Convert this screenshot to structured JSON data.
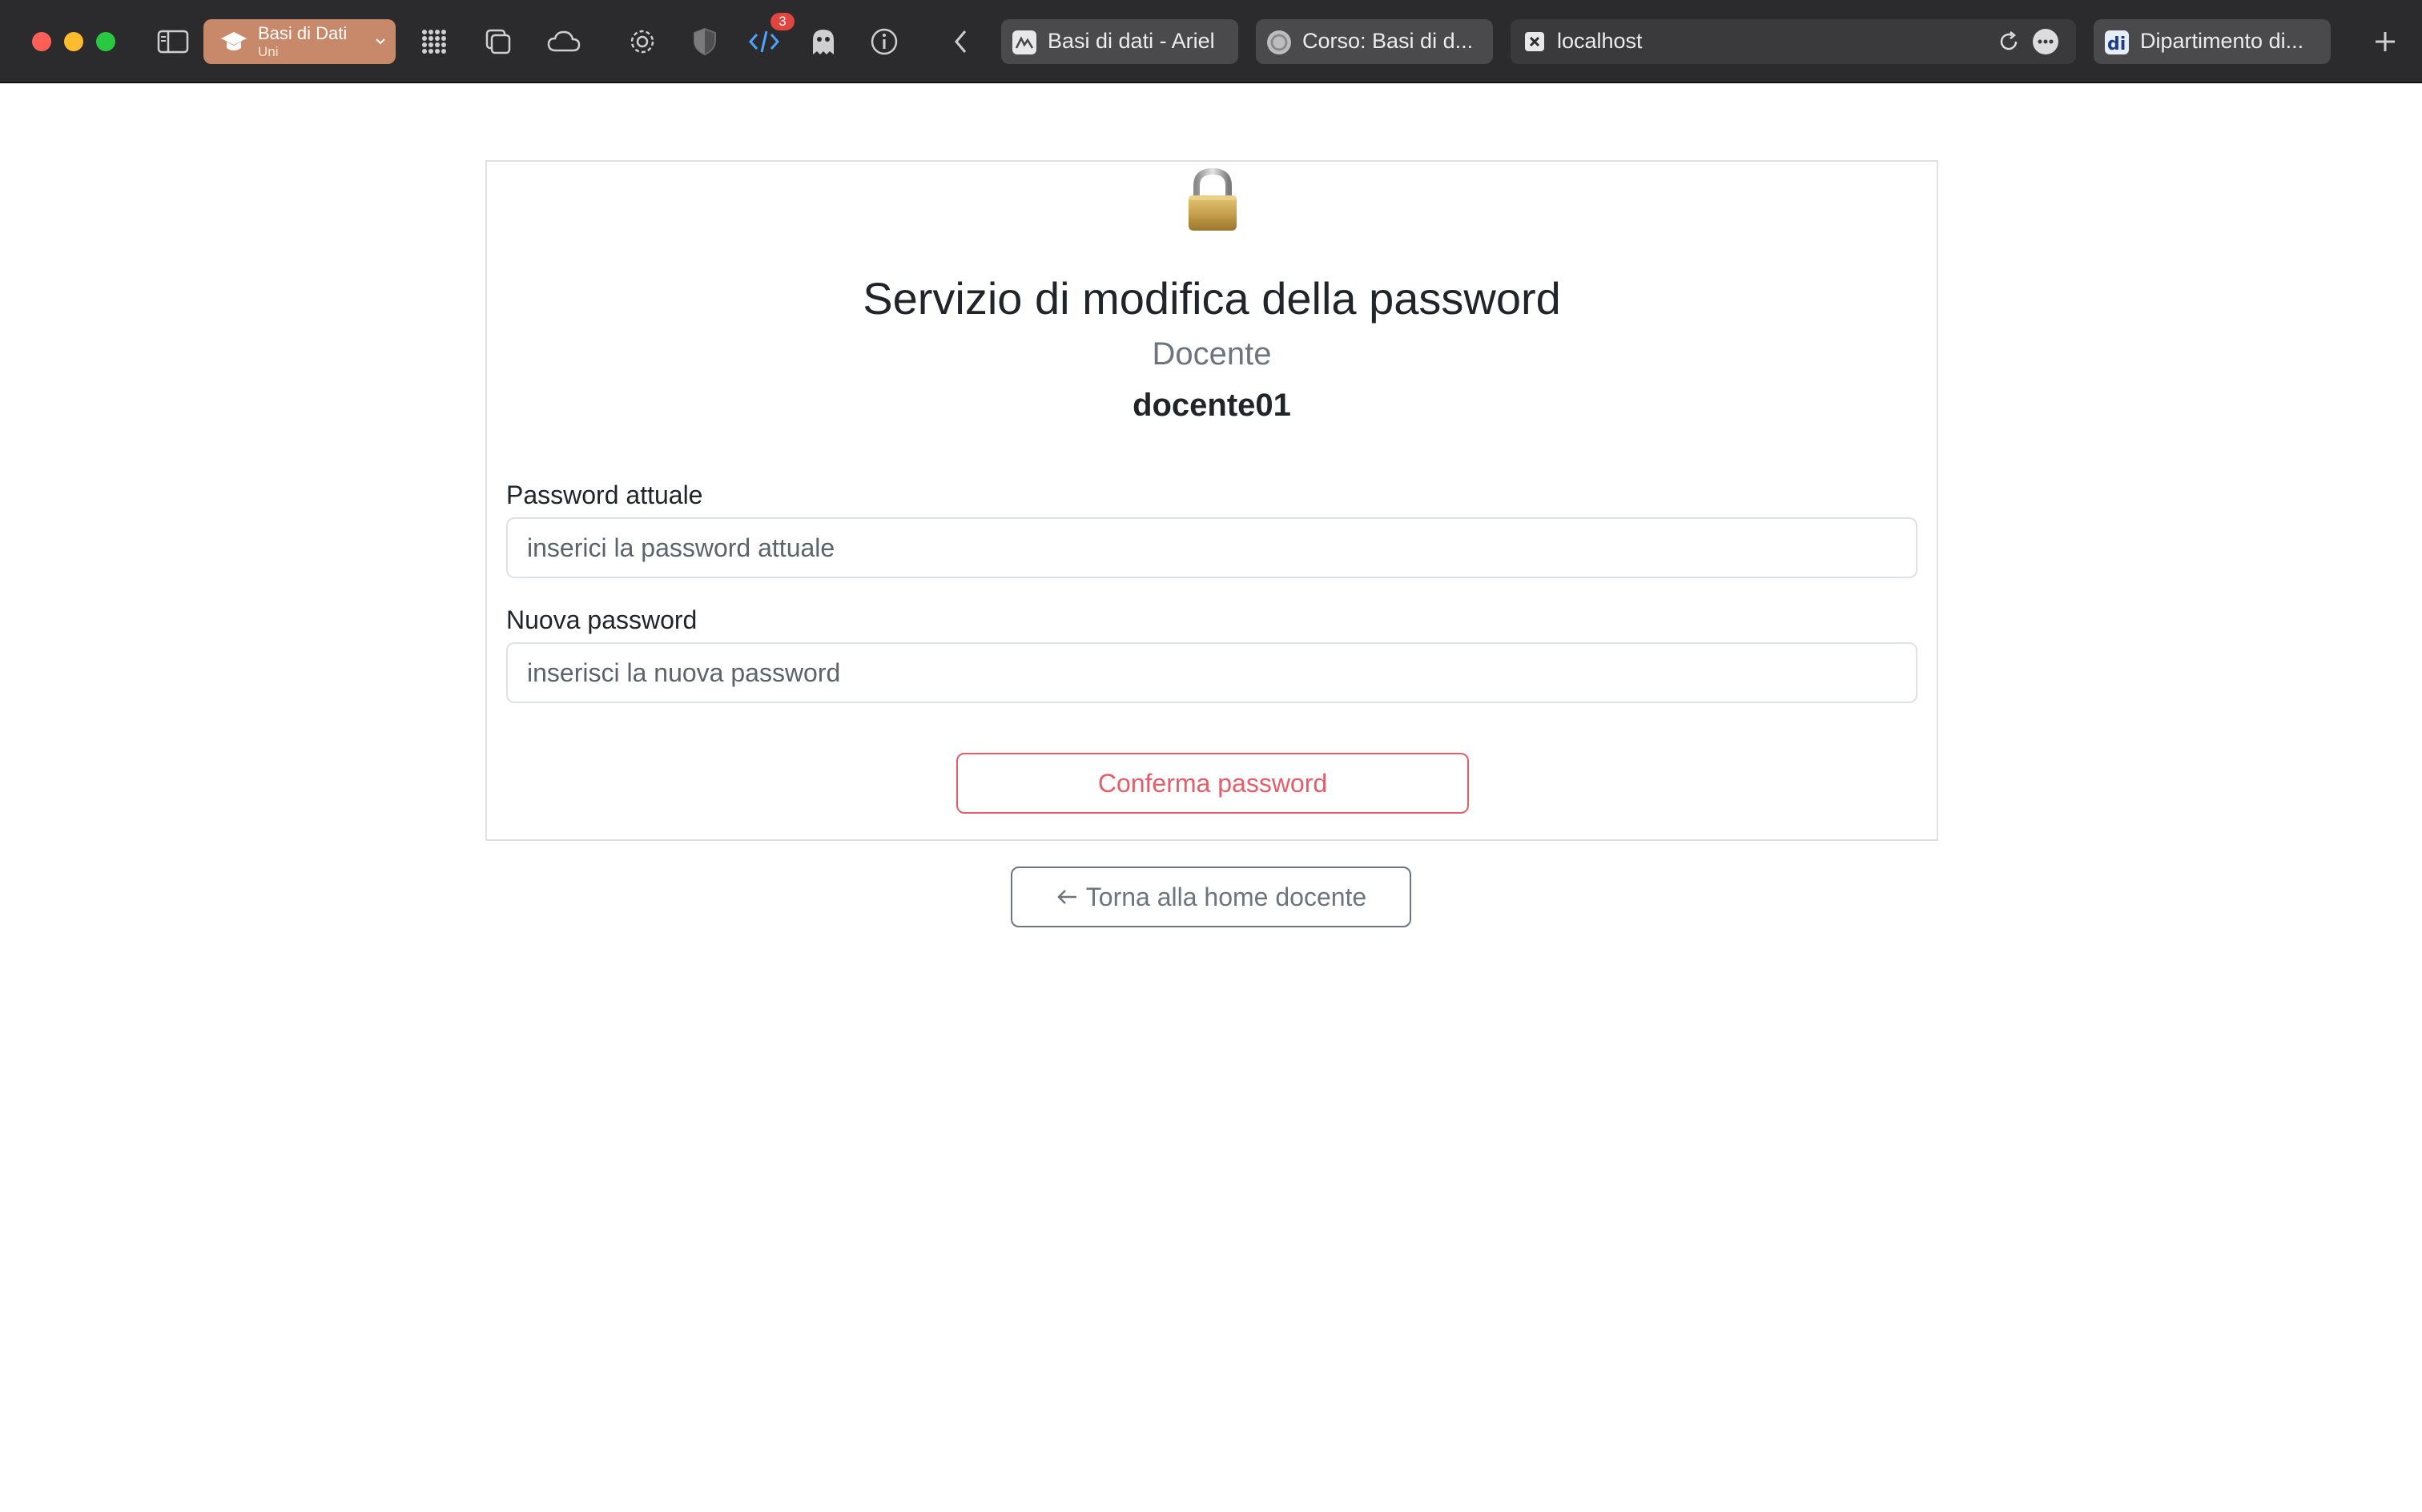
{
  "browser": {
    "tab_group": {
      "name": "Basi di Dati",
      "subtitle": "Uni",
      "color": "#c8896a"
    },
    "extension_badge": "3",
    "tabs": [
      {
        "label": "Basi di dati - Ariel",
        "icon": "ariel-icon"
      },
      {
        "label": "Corso: Basi di d...",
        "icon": "course-icon"
      },
      {
        "label": "localhost",
        "icon": "close-square-icon",
        "active": true
      },
      {
        "label": "Dipartimento di...",
        "icon": "di-icon"
      }
    ]
  },
  "page": {
    "title": "Servizio di modifica della password",
    "role": "Docente",
    "username": "docente01",
    "current_password": {
      "label": "Password attuale",
      "placeholder": "inserici la password attuale",
      "value": ""
    },
    "new_password": {
      "label": "Nuova password",
      "placeholder": "inserisci la nuova password",
      "value": ""
    },
    "confirm_button": "Conferma password",
    "back_button": "Torna alla home docente",
    "colors": {
      "danger": "#e35d6a",
      "secondary": "#6c757d"
    }
  }
}
